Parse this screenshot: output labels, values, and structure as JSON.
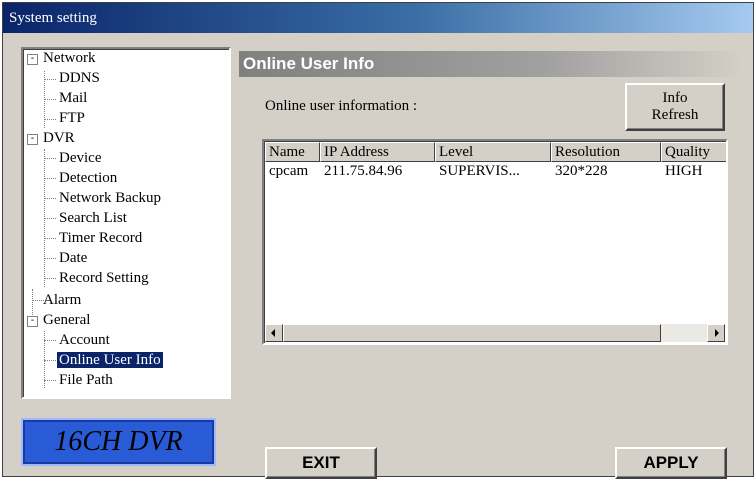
{
  "window": {
    "title": "System setting"
  },
  "tree": {
    "network": {
      "label": "Network",
      "expander": "-",
      "children": [
        "DDNS",
        "Mail",
        "FTP"
      ]
    },
    "dvr": {
      "label": "DVR",
      "expander": "-",
      "children": [
        "Device",
        "Detection",
        "Network Backup",
        "Search List",
        "Timer Record",
        "Date",
        "Record Setting"
      ]
    },
    "alarm": {
      "label": "Alarm"
    },
    "general": {
      "label": "General",
      "expander": "-",
      "children": [
        "Account",
        "Online User Info",
        "File Path"
      ]
    },
    "selected": "Online User Info"
  },
  "logo": {
    "text": "16CH DVR"
  },
  "panel": {
    "header": "Online User Info",
    "online_label": "Online user information :",
    "refresh_line1": "Info",
    "refresh_line2": "Refresh"
  },
  "list": {
    "columns": [
      "Name",
      "IP Address",
      "Level",
      "Resolution",
      "Quality"
    ],
    "rows": [
      [
        "cpcam",
        "211.75.84.96",
        "SUPERVIS...",
        "320*228",
        "HIGH"
      ]
    ]
  },
  "buttons": {
    "exit": "EXIT",
    "apply": "APPLY"
  },
  "colors": {
    "title_bar": "#0a246a",
    "selection": "#0a246a",
    "logo_bg": "#2a5bd7",
    "face": "#d4d0c8"
  },
  "icons": {
    "scroll_left": "left-arrow-icon",
    "scroll_right": "right-arrow-icon"
  }
}
